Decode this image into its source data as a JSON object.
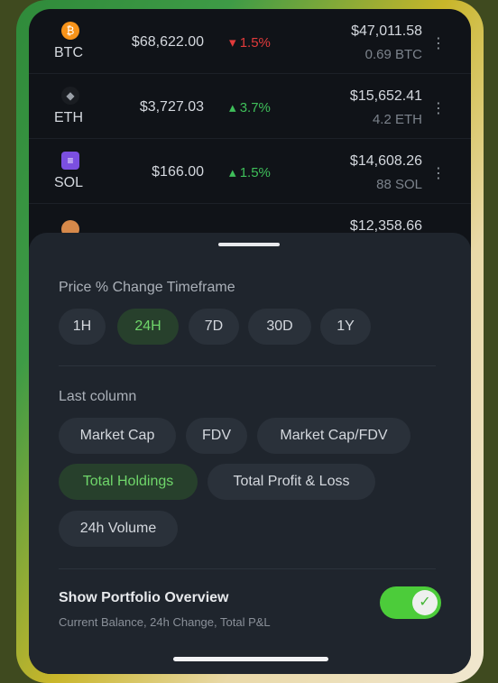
{
  "coins": [
    {
      "symbol": "BTC",
      "icon": "bitcoin-icon",
      "icon_glyph": "₿",
      "icon_color": "#f7931a",
      "price": "$68,622.00",
      "change": "1.5%",
      "direction": "down",
      "holding_value": "$47,011.58",
      "holding_amount": "0.69 BTC"
    },
    {
      "symbol": "ETH",
      "icon": "ethereum-icon",
      "icon_glyph": "◆",
      "icon_color": "#3b3f46",
      "price": "$3,727.03",
      "change": "3.7%",
      "direction": "up",
      "holding_value": "$15,652.41",
      "holding_amount": "4.2 ETH"
    },
    {
      "symbol": "SOL",
      "icon": "solana-icon",
      "icon_glyph": "≡",
      "icon_color": "#7b4fe0",
      "price": "$166.00",
      "change": "1.5%",
      "direction": "up",
      "holding_value": "$14,608.26",
      "holding_amount": "88 SOL"
    },
    {
      "symbol": "",
      "icon": "coin-icon",
      "icon_glyph": "",
      "icon_color": "#d6894a",
      "price": "",
      "change": "",
      "direction": "down",
      "holding_value": "$12,358.66",
      "holding_amount": ""
    }
  ],
  "colors": {
    "up": "#3fbf5a",
    "down": "#e23b3b",
    "accent": "#4ccc3a"
  },
  "sheet": {
    "timeframe_title": "Price % Change Timeframe",
    "timeframes": [
      "1H",
      "24H",
      "7D",
      "30D",
      "1Y"
    ],
    "selected_timeframe": "24H",
    "last_column_title": "Last column",
    "last_columns": [
      "Market Cap",
      "FDV",
      "Market Cap/FDV",
      "Total Holdings",
      "Total Profit & Loss",
      "24h Volume"
    ],
    "selected_last_column": "Total Holdings",
    "portfolio_overview_title": "Show Portfolio Overview",
    "portfolio_overview_sub": "Current Balance, 24h Change, Total P&L",
    "portfolio_overview_enabled": true
  }
}
